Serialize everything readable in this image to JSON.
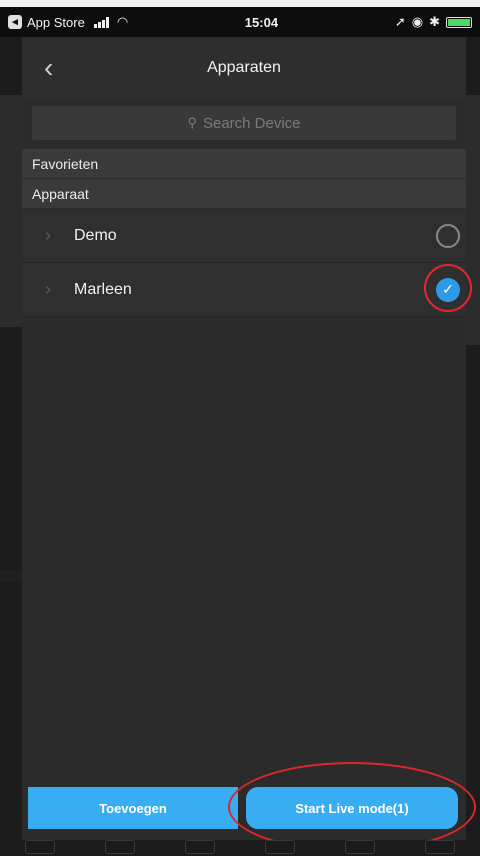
{
  "statusbar": {
    "back_app": "App Store",
    "time": "15:04"
  },
  "nav": {
    "title": "Apparaten"
  },
  "search": {
    "placeholder": "Search Device"
  },
  "sections": {
    "favorites": "Favorieten",
    "device": "Apparaat"
  },
  "devices": [
    {
      "label": "Demo",
      "selected": false
    },
    {
      "label": "Marleen",
      "selected": true
    }
  ],
  "actions": {
    "add_label": "Toevoegen",
    "live_label": "Start Live mode(1)"
  },
  "colors": {
    "accent": "#39adf2",
    "check": "#2e9be8",
    "annotation": "#e0262c"
  }
}
